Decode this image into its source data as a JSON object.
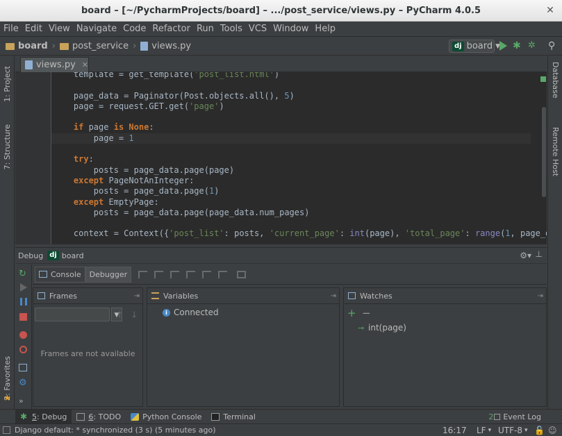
{
  "window": {
    "title": "board – [~/PycharmProjects/board] – .../post_service/views.py – PyCharm 4.0.5",
    "close_glyph": "✕"
  },
  "menu": [
    "File",
    "Edit",
    "View",
    "Navigate",
    "Code",
    "Refactor",
    "Run",
    "Tools",
    "VCS",
    "Window",
    "Help"
  ],
  "navbar": {
    "crumbs": [
      "board",
      "post_service",
      "views.py"
    ],
    "run_config": {
      "badge": "dj",
      "label": "board"
    }
  },
  "left_stripe": {
    "project": "1: Project",
    "structure": "7: Structure",
    "favorites": "2: Favorites"
  },
  "right_stripe": {
    "database": "Database",
    "remote_host": "Remote Host"
  },
  "editor": {
    "tab_label": "views.py",
    "lines": [
      [
        [
          "n",
          "    template = get_template("
        ],
        [
          "s",
          "'post_list.html'"
        ],
        [
          "n",
          ")"
        ]
      ],
      [
        [
          "n",
          ""
        ]
      ],
      [
        [
          "n",
          "    page_data = Paginator(Post.objects.all(), "
        ],
        [
          "d",
          "5"
        ],
        [
          "n",
          ")"
        ]
      ],
      [
        [
          "n",
          "    page = request.GET.get("
        ],
        [
          "s",
          "'page'"
        ],
        [
          "n",
          ")"
        ]
      ],
      [
        [
          "n",
          ""
        ]
      ],
      [
        [
          "n",
          "    "
        ],
        [
          "k",
          "if"
        ],
        [
          "n",
          " page "
        ],
        [
          "k",
          "is"
        ],
        [
          "n",
          " "
        ],
        [
          "k",
          "None"
        ],
        [
          "n",
          ":"
        ]
      ],
      [
        [
          "n",
          "        page = "
        ],
        [
          "d",
          "1"
        ]
      ],
      [
        [
          "n",
          ""
        ]
      ],
      [
        [
          "n",
          "    "
        ],
        [
          "k",
          "try"
        ],
        [
          "n",
          ":"
        ]
      ],
      [
        [
          "n",
          "        posts = page_data.page(page)"
        ]
      ],
      [
        [
          "n",
          "    "
        ],
        [
          "k",
          "except"
        ],
        [
          "n",
          " PageNotAnInteger:"
        ]
      ],
      [
        [
          "n",
          "        posts = page_data.page("
        ],
        [
          "d",
          "1"
        ],
        [
          "n",
          ")"
        ]
      ],
      [
        [
          "n",
          "    "
        ],
        [
          "k",
          "except"
        ],
        [
          "n",
          " EmptyPage:"
        ]
      ],
      [
        [
          "n",
          "        posts = page_data.page(page_data.num_pages)"
        ]
      ],
      [
        [
          "n",
          ""
        ]
      ],
      [
        [
          "n",
          "    context = Context({"
        ],
        [
          "s",
          "'post_list'"
        ],
        [
          "n",
          ": posts, "
        ],
        [
          "s",
          "'current_page'"
        ],
        [
          "n",
          ": "
        ],
        [
          "b",
          "int"
        ],
        [
          "n",
          "(page), "
        ],
        [
          "s",
          "'total_page'"
        ],
        [
          "n",
          ": "
        ],
        [
          "b",
          "range"
        ],
        [
          "n",
          "("
        ],
        [
          "d",
          "1"
        ],
        [
          "n",
          ", page_data.num"
        ]
      ]
    ],
    "current_line_index": 6
  },
  "debug": {
    "header_label": "Debug",
    "config_badge": "dj",
    "config_name": "board",
    "tabs": {
      "console": "Console",
      "debugger": "Debugger"
    },
    "frames": {
      "title": "Frames",
      "empty": "Frames are not available"
    },
    "variables": {
      "title": "Variables",
      "status": "Connected"
    },
    "watches": {
      "title": "Watches",
      "item": "int(page)"
    }
  },
  "bottom_tabs": {
    "debug": {
      "num": "5",
      "label": ": Debug"
    },
    "todo": {
      "num": "6",
      "label": ": TODO"
    },
    "python_console": "Python Console",
    "terminal": "Terminal",
    "event_log": {
      "count": "2",
      "label": "Event Log"
    }
  },
  "status": {
    "message": "Django default: * synchronized (3 s) (5 minutes ago)",
    "position": "16:17",
    "line_sep": "LF",
    "encoding": "UTF-8"
  },
  "colors": {
    "keyword": "#cc7832",
    "string": "#6a8759",
    "number": "#6897bb",
    "builtin": "#8888c6",
    "run_green": "#59a869"
  }
}
